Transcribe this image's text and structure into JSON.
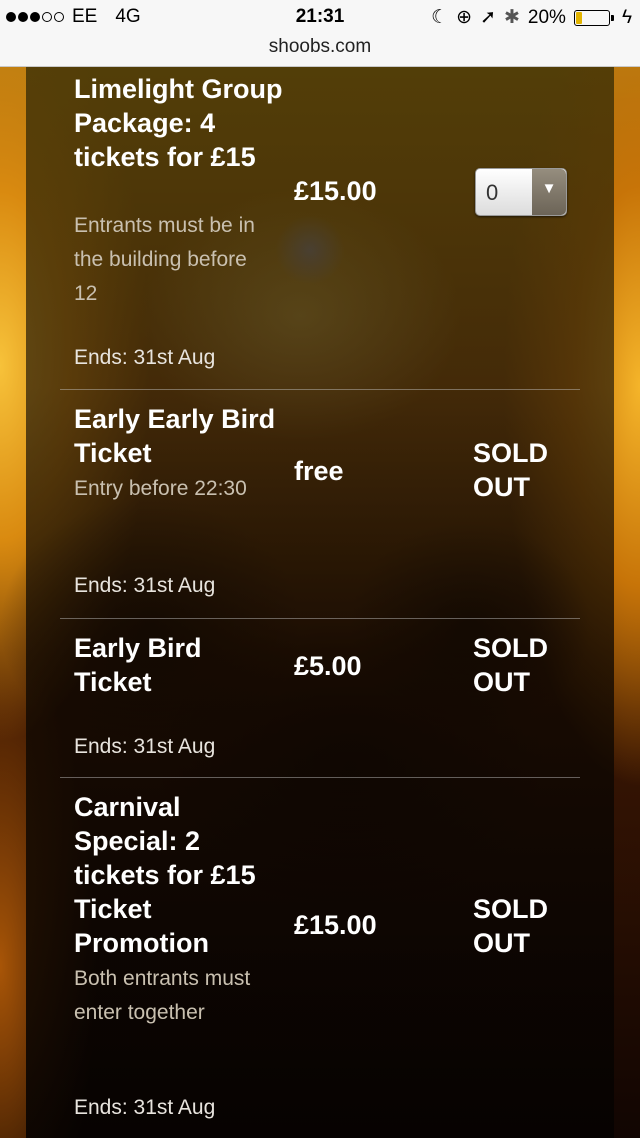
{
  "status_bar": {
    "signal_filled": 3,
    "signal_total": 5,
    "carrier": "EE",
    "network": "4G",
    "time": "21:31",
    "battery_percent": "20%",
    "battery_level": 0.2,
    "battery_color": "#e2b400",
    "icons": [
      "moon-icon",
      "rotation-lock-icon",
      "location-arrow-icon",
      "bluetooth-icon",
      "battery-icon",
      "charging-bolt-icon"
    ]
  },
  "browser": {
    "url": "shoobs.com"
  },
  "tickets": [
    {
      "name": "Limelight Group Package: 4 tickets for £15",
      "description": "Entrants must be in the building before 12",
      "price": "£15.00",
      "ends": "Ends: 31st Aug",
      "quantity_selected": "0"
    },
    {
      "name": "Early Early Bird Ticket",
      "description": "Entry before 22:30",
      "price": "free",
      "ends": "Ends: 31st Aug",
      "status": "SOLD OUT"
    },
    {
      "name": "Early Bird Ticket",
      "description": "",
      "price": "£5.00",
      "ends": "Ends: 31st Aug",
      "status": "SOLD OUT"
    },
    {
      "name": "Carnival Special: 2 tickets for £15 Ticket Promotion",
      "description": "Both entrants must enter together",
      "price": "£15.00",
      "ends": "Ends: 31st Aug",
      "status": "SOLD OUT"
    }
  ]
}
